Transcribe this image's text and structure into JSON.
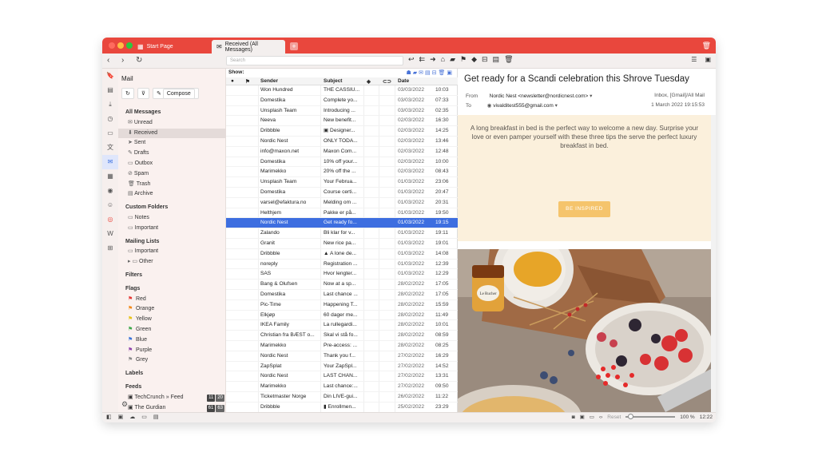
{
  "titlebar": {
    "tab_inactive": "Start Page",
    "tab_active": "Received (All Messages)"
  },
  "toolbar": {
    "search_placeholder": "Search"
  },
  "sidebar": {
    "title": "Mail",
    "compose": "Compose",
    "items": [
      {
        "t": "h",
        "label": "All Messages"
      },
      {
        "t": "i",
        "label": "Unread",
        "icon": "✉"
      },
      {
        "t": "i",
        "label": "Received",
        "icon": "⬇",
        "sel": true
      },
      {
        "t": "i",
        "label": "Sent",
        "icon": "➤"
      },
      {
        "t": "i",
        "label": "Drafts",
        "icon": "✎"
      },
      {
        "t": "i",
        "label": "Outbox",
        "icon": "▭"
      },
      {
        "t": "i",
        "label": "Spam",
        "icon": "⊘"
      },
      {
        "t": "i",
        "label": "Trash",
        "icon": "🗑"
      },
      {
        "t": "i",
        "label": "Archive",
        "icon": "▤"
      },
      {
        "t": "g"
      },
      {
        "t": "h",
        "label": "Custom Folders"
      },
      {
        "t": "i",
        "label": "Notes",
        "icon": "▭"
      },
      {
        "t": "i",
        "label": "Important",
        "icon": "▭"
      },
      {
        "t": "g"
      },
      {
        "t": "h",
        "label": "Mailing Lists"
      },
      {
        "t": "i",
        "label": "Important",
        "icon": "▭"
      },
      {
        "t": "i2",
        "label": "Other",
        "icon": "▸ ▭"
      },
      {
        "t": "g"
      },
      {
        "t": "h",
        "label": "Filters"
      },
      {
        "t": "g"
      },
      {
        "t": "h",
        "label": "Flags"
      },
      {
        "t": "f",
        "label": "Red",
        "color": "#e53935"
      },
      {
        "t": "f",
        "label": "Orange",
        "color": "#f28a1b"
      },
      {
        "t": "f",
        "label": "Yellow",
        "color": "#e8c319"
      },
      {
        "t": "f",
        "label": "Green",
        "color": "#3ea84a"
      },
      {
        "t": "f",
        "label": "Blue",
        "color": "#3b74d9"
      },
      {
        "t": "f",
        "label": "Purple",
        "color": "#8e44ad"
      },
      {
        "t": "f",
        "label": "Grey",
        "color": "#8a8a8a"
      },
      {
        "t": "g"
      },
      {
        "t": "h",
        "label": "Labels"
      },
      {
        "t": "g"
      },
      {
        "t": "h",
        "label": "Feeds"
      },
      {
        "t": "feed",
        "label": "TechCrunch » Feed",
        "a": "11",
        "b": "20"
      },
      {
        "t": "feed",
        "label": "The Gurdian",
        "a": "61",
        "b": "63"
      }
    ]
  },
  "list": {
    "show_label": "Show:",
    "headers": {
      "sender": "Sender",
      "subject": "Subject",
      "date": "Date"
    },
    "rows": [
      [
        "Won Hundred",
        "THE CASSIU...",
        "03/03/2022",
        "10:03"
      ],
      [
        "Domestika",
        "Complete yo...",
        "03/03/2022",
        "07:33"
      ],
      [
        "Unsplash Team",
        "Introducing ...",
        "03/03/2022",
        "02:35"
      ],
      [
        "Neeva",
        "New benefit...",
        "02/03/2022",
        "16:30"
      ],
      [
        "Dribbble",
        "▣ Designer...",
        "02/03/2022",
        "14:25"
      ],
      [
        "Nordic Nest",
        "ONLY TODA...",
        "02/03/2022",
        "13:46"
      ],
      [
        "info@maxon.net",
        "Maxon Com...",
        "02/03/2022",
        "12:48"
      ],
      [
        "Domestika",
        "10% off your...",
        "02/03/2022",
        "10:00"
      ],
      [
        "Marimekko",
        "20% off the ...",
        "02/03/2022",
        "08:43"
      ],
      [
        "Unsplash Team",
        "Your Februa...",
        "01/03/2022",
        "23:06"
      ],
      [
        "Domestika",
        "Course certi...",
        "01/03/2022",
        "20:47"
      ],
      [
        "varsel@efaktura.no",
        "Melding om ...",
        "01/03/2022",
        "20:31"
      ],
      [
        "Helthjem",
        "Pakke er på...",
        "01/03/2022",
        "19:50"
      ],
      [
        "Nordic Nest",
        "Get ready fo...",
        "01/03/2022",
        "19:15"
      ],
      [
        "Zalando",
        "Bli klar for v...",
        "01/03/2022",
        "19:11"
      ],
      [
        "Granit",
        "New rice pa...",
        "01/03/2022",
        "19:01"
      ],
      [
        "Dribbble",
        "▲ A lone de...",
        "01/03/2022",
        "14:08"
      ],
      [
        "noreply",
        "Registration ...",
        "01/03/2022",
        "12:39"
      ],
      [
        "SAS",
        "Hvor lengter...",
        "01/03/2022",
        "12:29"
      ],
      [
        "Bang & Olufsen",
        "Now at a sp...",
        "28/02/2022",
        "17:05"
      ],
      [
        "Domestika",
        "Last chance ...",
        "28/02/2022",
        "17:05"
      ],
      [
        "Pic-Time",
        "Happening T...",
        "28/02/2022",
        "15:59"
      ],
      [
        "Elkjøp",
        "60 dager me...",
        "28/02/2022",
        "11:49"
      ],
      [
        "IKEA Family",
        "La rullegardi...",
        "28/02/2022",
        "10:01"
      ],
      [
        "Christian fra BÆST o...",
        "Skal vi stå fo...",
        "28/02/2022",
        "08:59"
      ],
      [
        "Marimekko",
        "Pre-access: ...",
        "28/02/2022",
        "08:25"
      ],
      [
        "Nordic Nest",
        "Thank you f...",
        "27/02/2022",
        "16:29"
      ],
      [
        "ZapSplat",
        "Your ZapSpl...",
        "27/02/2022",
        "14:52"
      ],
      [
        "Nordic Nest",
        "LAST CHAN...",
        "27/02/2022",
        "13:31"
      ],
      [
        "Marimekko",
        "Last chance:...",
        "27/02/2022",
        "09:50"
      ],
      [
        "Ticketmaster Norge",
        "Din LIVE-gui...",
        "26/02/2022",
        "11:22"
      ],
      [
        "Dribbble",
        "▮ Enrollmen...",
        "25/02/2022",
        "23:29"
      ]
    ],
    "selected_index": 13
  },
  "reader": {
    "subject": "Get ready for a Scandi celebration this Shrove Tuesday",
    "from_label": "From",
    "from": "Nordic Nest <newsletter@nordicnest.com>",
    "folder": "Inbox, [Gmail]/All Mail",
    "to_label": "To",
    "to": "vivalditest555@gmail.com",
    "date": "1 March 2022 19:15:53",
    "banner_text": "A long breakfast in bed is the perfect way to welcome a new day. Surprise your love or even pamper yourself with these three tips the serve the perfect luxury breakfast in bed.",
    "cta": "BE INSPIRED",
    "jar_label": "Le Rucher"
  },
  "status": {
    "reset": "Reset",
    "zoom": "100 %",
    "time": "12:22"
  }
}
